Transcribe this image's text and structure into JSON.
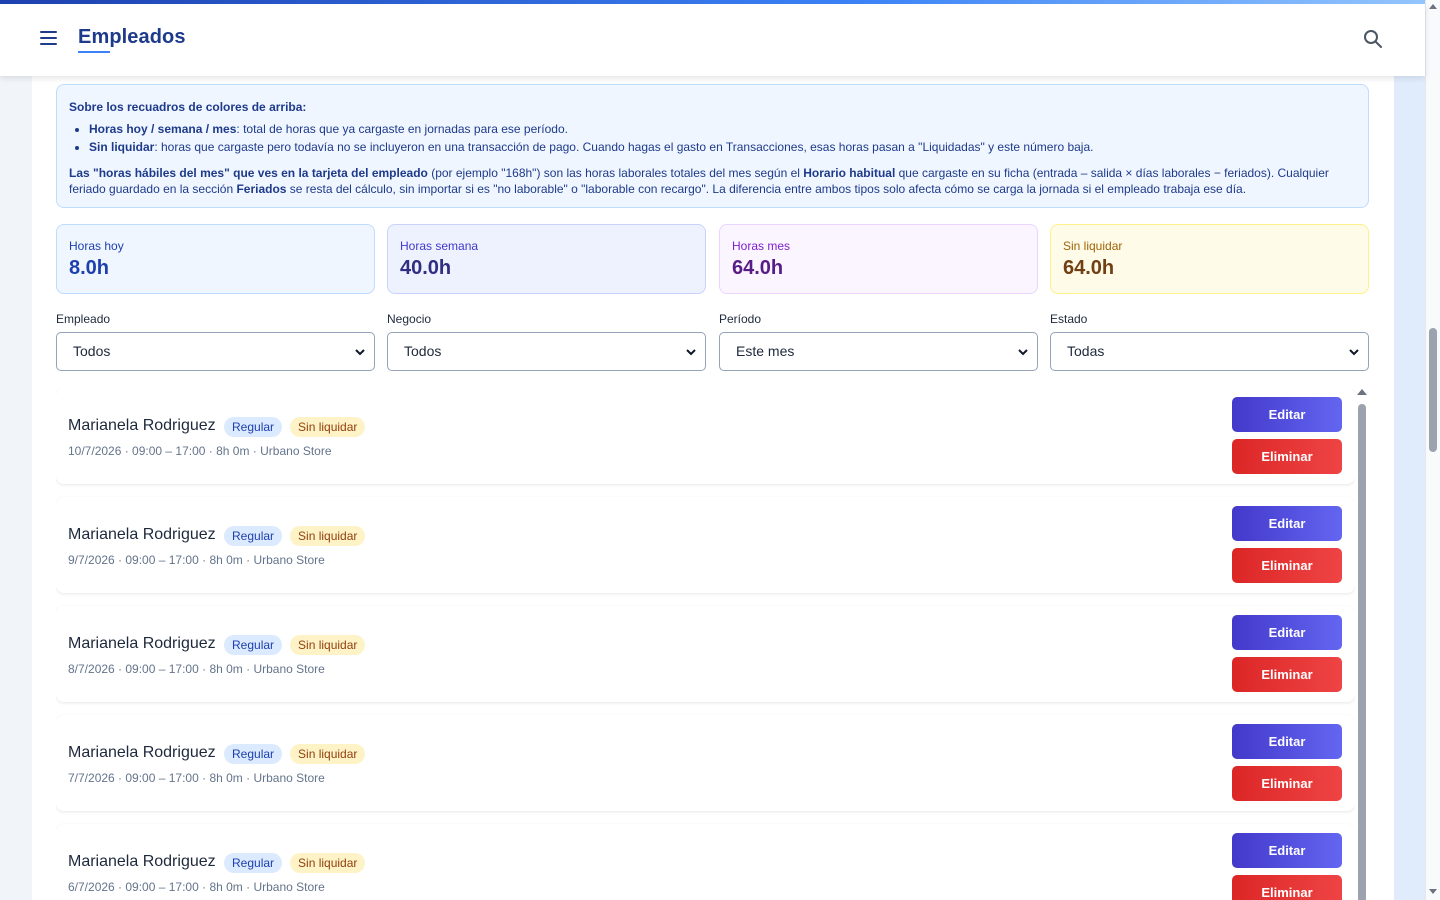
{
  "header": {
    "title": "Empleados"
  },
  "info": {
    "heading": "Sobre los recuadros de colores de arriba:",
    "bullet1_strong": "Horas hoy / semana / mes",
    "bullet1_text": ": total de horas que ya cargaste en jornadas para ese período.",
    "bullet2_strong": "Sin liquidar",
    "bullet2_text": ": horas que cargaste pero todavía no se incluyeron en una transacción de pago. Cuando hagas el gasto en Transacciones, esas horas pasan a \"Liquidadas\" y este número baja.",
    "p_strong1": "Las \"horas hábiles del mes\" que ves en la tarjeta del empleado",
    "p_text1": " (por ejemplo \"168h\") son las horas laborales totales del mes según el ",
    "p_strong2": "Horario habitual",
    "p_text2": " que cargaste en su ficha (entrada – salida × días laborales − feriados). Cualquier feriado guardado en la sección ",
    "p_strong3": "Feriados",
    "p_text3": " se resta del cálculo, sin importar si es \"no laborable\" o \"laborable con recargo\". La diferencia entre ambos tipos solo afecta cómo se carga la jornada si el empleado trabaja ese día."
  },
  "stats": {
    "hoy_label": "Horas hoy",
    "hoy_value": "8.0h",
    "semana_label": "Horas semana",
    "semana_value": "40.0h",
    "mes_label": "Horas mes",
    "mes_value": "64.0h",
    "sin_label": "Sin liquidar",
    "sin_value": "64.0h"
  },
  "filters": {
    "empleado_label": "Empleado",
    "empleado_value": "Todos",
    "negocio_label": "Negocio",
    "negocio_value": "Todos",
    "periodo_label": "Período",
    "periodo_value": "Este mes",
    "estado_label": "Estado",
    "estado_value": "Todas"
  },
  "actions": {
    "edit_label": "Editar",
    "delete_label": "Eliminar"
  },
  "records": [
    {
      "name": "Marianela Rodriguez",
      "type": "Regular",
      "status": "Sin liquidar",
      "meta": "10/7/2026 · 09:00 – 17:00 · 8h 0m · Urbano Store"
    },
    {
      "name": "Marianela Rodriguez",
      "type": "Regular",
      "status": "Sin liquidar",
      "meta": "9/7/2026 · 09:00 – 17:00 · 8h 0m · Urbano Store"
    },
    {
      "name": "Marianela Rodriguez",
      "type": "Regular",
      "status": "Sin liquidar",
      "meta": "8/7/2026 · 09:00 – 17:00 · 8h 0m · Urbano Store"
    },
    {
      "name": "Marianela Rodriguez",
      "type": "Regular",
      "status": "Sin liquidar",
      "meta": "7/7/2026 · 09:00 – 17:00 · 8h 0m · Urbano Store"
    },
    {
      "name": "Marianela Rodriguez",
      "type": "Regular",
      "status": "Sin liquidar",
      "meta": "6/7/2026 · 09:00 – 17:00 · 8h 0m · Urbano Store"
    }
  ]
}
